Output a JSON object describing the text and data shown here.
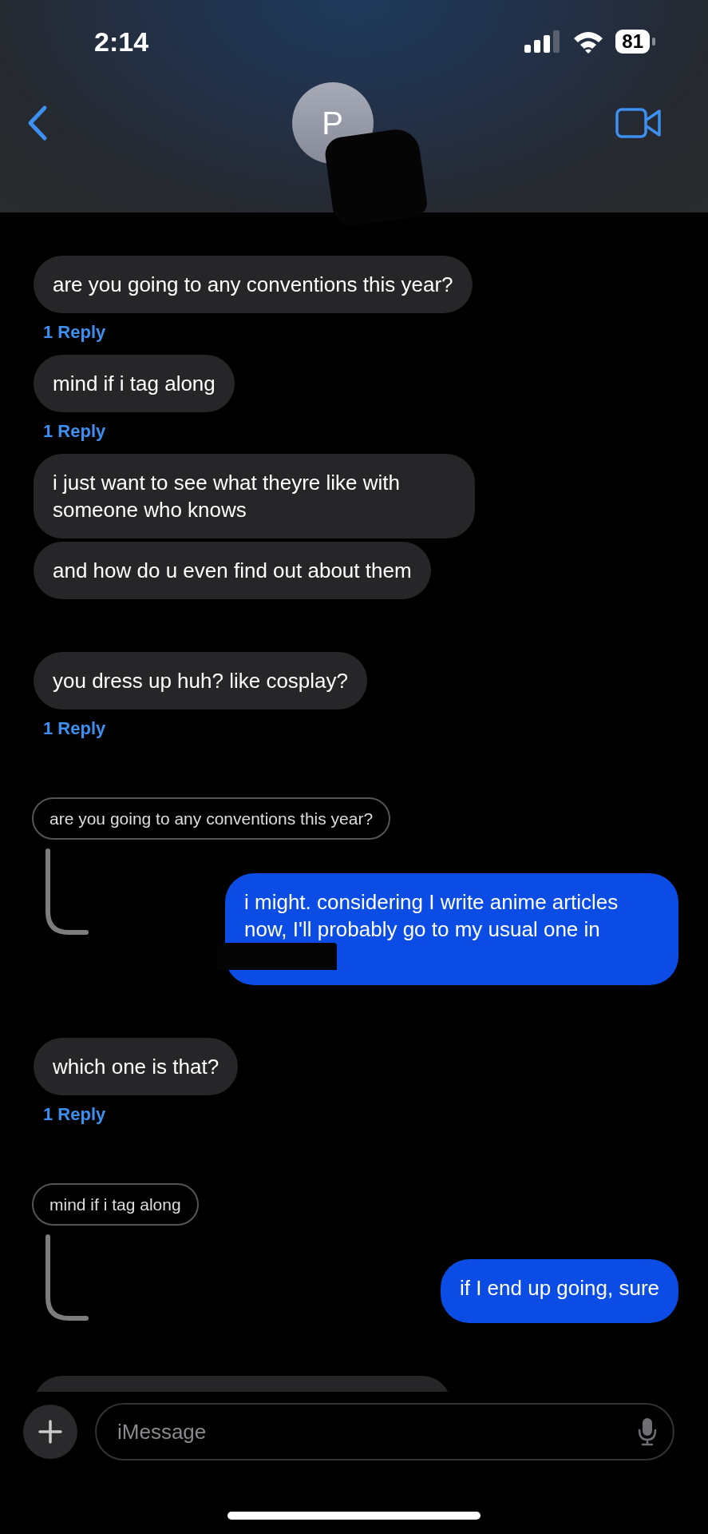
{
  "status_bar": {
    "time": "2:14",
    "battery": "81"
  },
  "header": {
    "contact_initial": "P"
  },
  "groups": [
    {
      "items": [
        {
          "kind": "received",
          "text": "are you going to any conventions this year?"
        },
        {
          "kind": "reply_count",
          "text": "1 Reply"
        },
        {
          "kind": "received",
          "text": "mind if i tag along"
        },
        {
          "kind": "reply_count",
          "text": "1 Reply"
        },
        {
          "kind": "received",
          "text": "i just want to see what theyre like with someone who knows"
        },
        {
          "kind": "received",
          "text": "and how do u even find out about them"
        }
      ]
    },
    {
      "items": [
        {
          "kind": "received",
          "text": "you dress up huh? like cosplay?"
        },
        {
          "kind": "reply_count",
          "text": "1 Reply"
        }
      ]
    },
    {
      "items": [
        {
          "kind": "quote",
          "text": "are you going to any conventions this year?"
        },
        {
          "kind": "sent",
          "text": "i might. considering I write anime articles now, I'll probably go to my usual one in",
          "redacted": true
        }
      ]
    },
    {
      "items": [
        {
          "kind": "received",
          "text": "which one is that?"
        },
        {
          "kind": "reply_count",
          "text": "1 Reply"
        }
      ]
    },
    {
      "items": [
        {
          "kind": "quote",
          "text": "mind if i tag along"
        },
        {
          "kind": "sent",
          "text": "if I end up going, sure",
          "redacted": false
        }
      ]
    },
    {
      "items": [
        {
          "kind": "received"
        }
      ]
    }
  ],
  "composer": {
    "placeholder": "iMessage"
  }
}
